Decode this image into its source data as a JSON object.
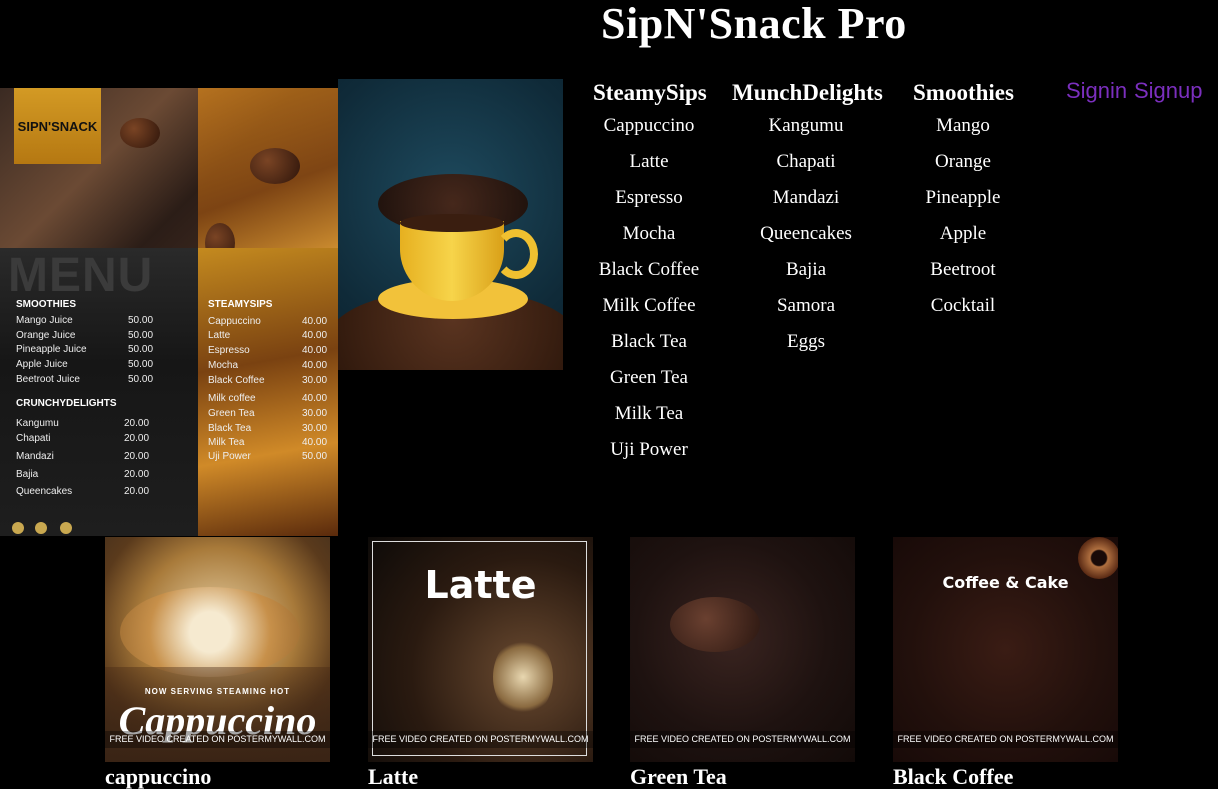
{
  "header": {
    "title": "SipN'Snack Pro",
    "signin_label": "Signin",
    "signup_label": "Signup"
  },
  "menus": [
    {
      "heading": "SteamySips",
      "items": [
        "Cappuccino",
        "Latte",
        "Espresso",
        "Mocha",
        "Black Coffee",
        "Milk Coffee",
        "Black Tea",
        "Green Tea",
        "Milk Tea",
        "Uji Power"
      ]
    },
    {
      "heading": "MunchDelights",
      "items": [
        "Kangumu",
        "Chapati",
        "Mandazi",
        "Queencakes",
        "Bajia",
        "Samora",
        "Eggs"
      ]
    },
    {
      "heading": "Smoothies",
      "items": [
        "Mango",
        "Orange",
        "Pineapple",
        "Apple",
        "Beetroot",
        "Cocktail"
      ]
    }
  ],
  "poster": {
    "logo": "SIPN'SNACK",
    "menu_word": "MENU",
    "smoothies": {
      "heading": "SMOOTHIES",
      "rows": [
        {
          "name": "Mango Juice",
          "price": "50.00"
        },
        {
          "name": "Orange Juice",
          "price": "50.00"
        },
        {
          "name": "Pineapple Juice",
          "price": "50.00"
        },
        {
          "name": "Apple Juice",
          "price": "50.00"
        },
        {
          "name": "Beetroot Juice",
          "price": "50.00"
        }
      ]
    },
    "crunchy": {
      "heading": "CRUNCHYDELIGHTS",
      "rows": [
        {
          "name": "Kangumu",
          "price": "20.00"
        },
        {
          "name": "Chapati",
          "price": "20.00"
        },
        {
          "name": "Mandazi",
          "price": "20.00"
        },
        {
          "name": "Bajia",
          "price": "20.00"
        },
        {
          "name": "Queencakes",
          "price": "20.00"
        }
      ]
    },
    "steamy": {
      "heading": "STEAMYSIPS",
      "rows": [
        {
          "name": "Cappuccino",
          "price": "40.00"
        },
        {
          "name": "Latte",
          "price": "40.00"
        },
        {
          "name": "Espresso",
          "price": "40.00"
        },
        {
          "name": "Mocha",
          "price": "40.00"
        },
        {
          "name": "Black Coffee",
          "price": "30.00"
        },
        {
          "name": "Milk coffee",
          "price": "40.00"
        },
        {
          "name": "Green Tea",
          "price": "30.00"
        },
        {
          "name": "Black Tea",
          "price": "30.00"
        },
        {
          "name": "Milk Tea",
          "price": "40.00"
        },
        {
          "name": "Uji Power",
          "price": "50.00"
        }
      ]
    }
  },
  "cards": [
    {
      "name": "cappuccino",
      "overlay": "Cappuccino",
      "tagline": "NOW SERVING STEAMING HOT",
      "watermark": "FREE VIDEO CREATED ON POSTERMYWALL.COM"
    },
    {
      "name": "Latte",
      "overlay": "Latte",
      "tagline": "",
      "watermark": "FREE VIDEO CREATED ON POSTERMYWALL.COM"
    },
    {
      "name": "Green Tea",
      "overlay": "",
      "tagline": "",
      "watermark": "FREE VIDEO CREATED ON POSTERMYWALL.COM"
    },
    {
      "name": "Black Coffee",
      "overlay": "Coffee & Cake",
      "tagline": "",
      "watermark": "FREE VIDEO CREATED ON POSTERMYWALL.COM"
    }
  ]
}
